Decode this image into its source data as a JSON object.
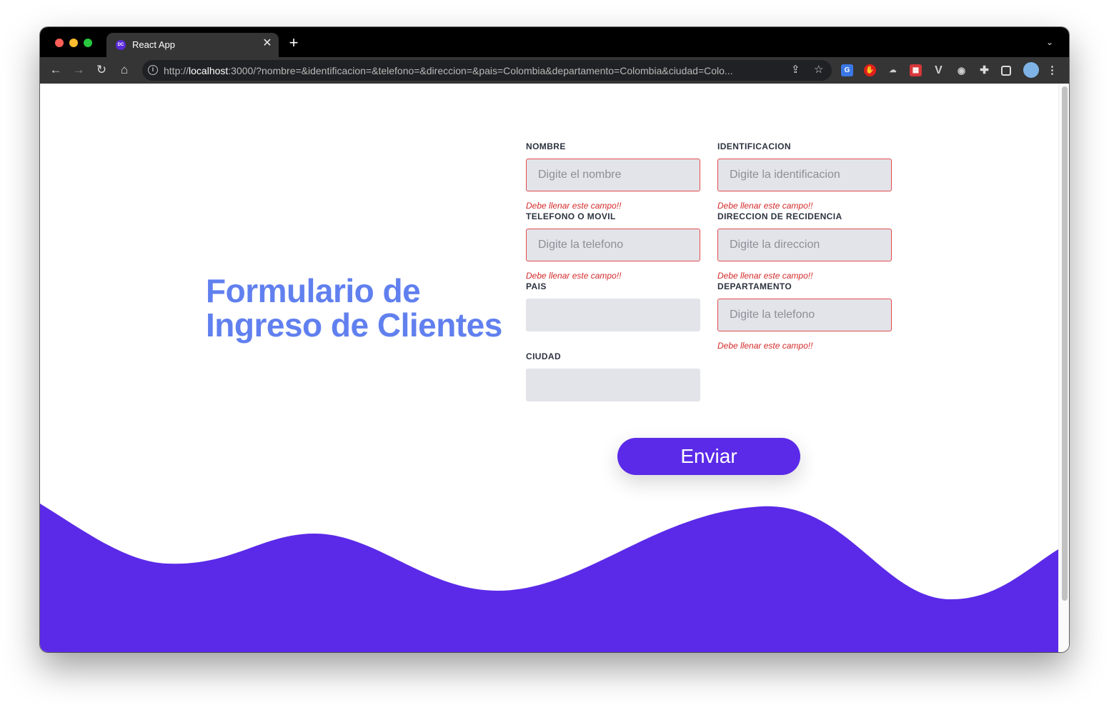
{
  "browser": {
    "tab_title": "React App",
    "tab_favicon_text": "DC",
    "tab_close": "✕",
    "new_tab": "+",
    "tab_list": "⌄",
    "url_prefix": "http://",
    "url_host": "localhost",
    "url_rest": ":3000/?nombre=&identificacion=&telefono=&direccion=&pais=Colombia&departamento=Colombia&ciudad=Colo..."
  },
  "form": {
    "title_line1": "Formulario de",
    "title_line2": "Ingreso de Clientes",
    "fields": [
      {
        "label": "NOMBRE",
        "placeholder": "Digite el nombre",
        "error": "Debe llenar este campo!!"
      },
      {
        "label": "IDENTIFICACION",
        "placeholder": "Digite la identificacion",
        "error": "Debe llenar este campo!!"
      },
      {
        "label": "TELEFONO O MOVIL",
        "placeholder": "Digite la telefono",
        "error": "Debe llenar este campo!!"
      },
      {
        "label": "DIRECCION DE RECIDENCIA",
        "placeholder": "Digite la direccion",
        "error": "Debe llenar este campo!!"
      },
      {
        "label": "PAIS",
        "placeholder": "",
        "error": ""
      },
      {
        "label": "DEPARTAMENTO",
        "placeholder": "Digite la telefono",
        "error": "Debe llenar este campo!!"
      },
      {
        "label": "CIUDAD",
        "placeholder": "",
        "error": ""
      }
    ],
    "submit_label": "Enviar"
  },
  "colors": {
    "accent": "#5b2ae8",
    "title": "#6180ef",
    "error": "#d42a2a",
    "wave": "#5b2ae8"
  }
}
